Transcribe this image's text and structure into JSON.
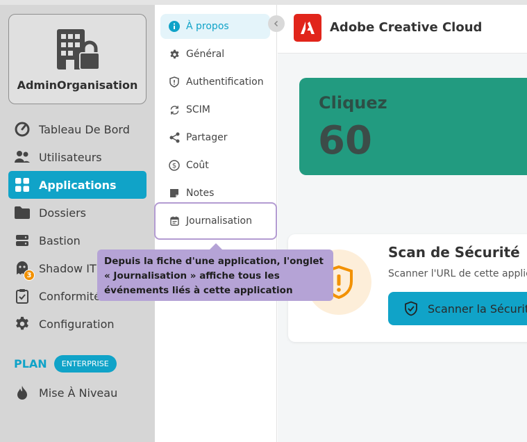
{
  "org": {
    "name": "AdminOrganisation",
    "icon": "building-lock-icon"
  },
  "nav": {
    "items": [
      {
        "label": "Tableau De Bord",
        "icon": "dashboard-gauge-icon"
      },
      {
        "label": "Utilisateurs",
        "icon": "users-icon"
      },
      {
        "label": "Applications",
        "icon": "grid-apps-icon",
        "active": true
      },
      {
        "label": "Dossiers",
        "icon": "folder-icon"
      },
      {
        "label": "Bastion",
        "icon": "server-icon"
      },
      {
        "label": "Shadow IT",
        "icon": "ghost-icon",
        "badge": "3"
      },
      {
        "label": "Conformité",
        "icon": "clipboard-check-icon"
      },
      {
        "label": "Configuration",
        "icon": "gear-icon"
      }
    ]
  },
  "plan": {
    "label": "PLAN",
    "tier": "ENTERPRISE"
  },
  "upgrade": {
    "label": "Mise À Niveau",
    "icon": "flame-icon"
  },
  "submenu": {
    "items": [
      {
        "label": "À propos",
        "icon": "info-icon",
        "active": true
      },
      {
        "label": "Général",
        "icon": "gear-icon"
      },
      {
        "label": "Authentification",
        "icon": "shield-icon"
      },
      {
        "label": "SCIM",
        "icon": "sync-icon"
      },
      {
        "label": "Partager",
        "icon": "share-icon"
      },
      {
        "label": "Coût",
        "icon": "dollar-coin-icon"
      },
      {
        "label": "Notes",
        "icon": "note-icon"
      },
      {
        "label": "Journalisation",
        "icon": "calendar-log-icon",
        "highlighted": true
      }
    ]
  },
  "app": {
    "name": "Adobe Creative Cloud",
    "logo": "adobe-logo-icon"
  },
  "stats": {
    "click_label": "Cliquez",
    "click_value": "60"
  },
  "scan": {
    "title": "Scan de Sécurité",
    "description": "Scanner l'URL de cette applic",
    "button_label": "Scanner la Sécurit"
  },
  "tooltip": {
    "text": "Depuis la fiche d'une application, l'onglet « Journalisation » affiche tous les événements liés à cette application"
  },
  "colors": {
    "accent": "#10a3c8",
    "card_green": "#229b80",
    "warning": "#f29100",
    "tooltip": "#b5a3d6",
    "adobe_red": "#e1251b"
  }
}
